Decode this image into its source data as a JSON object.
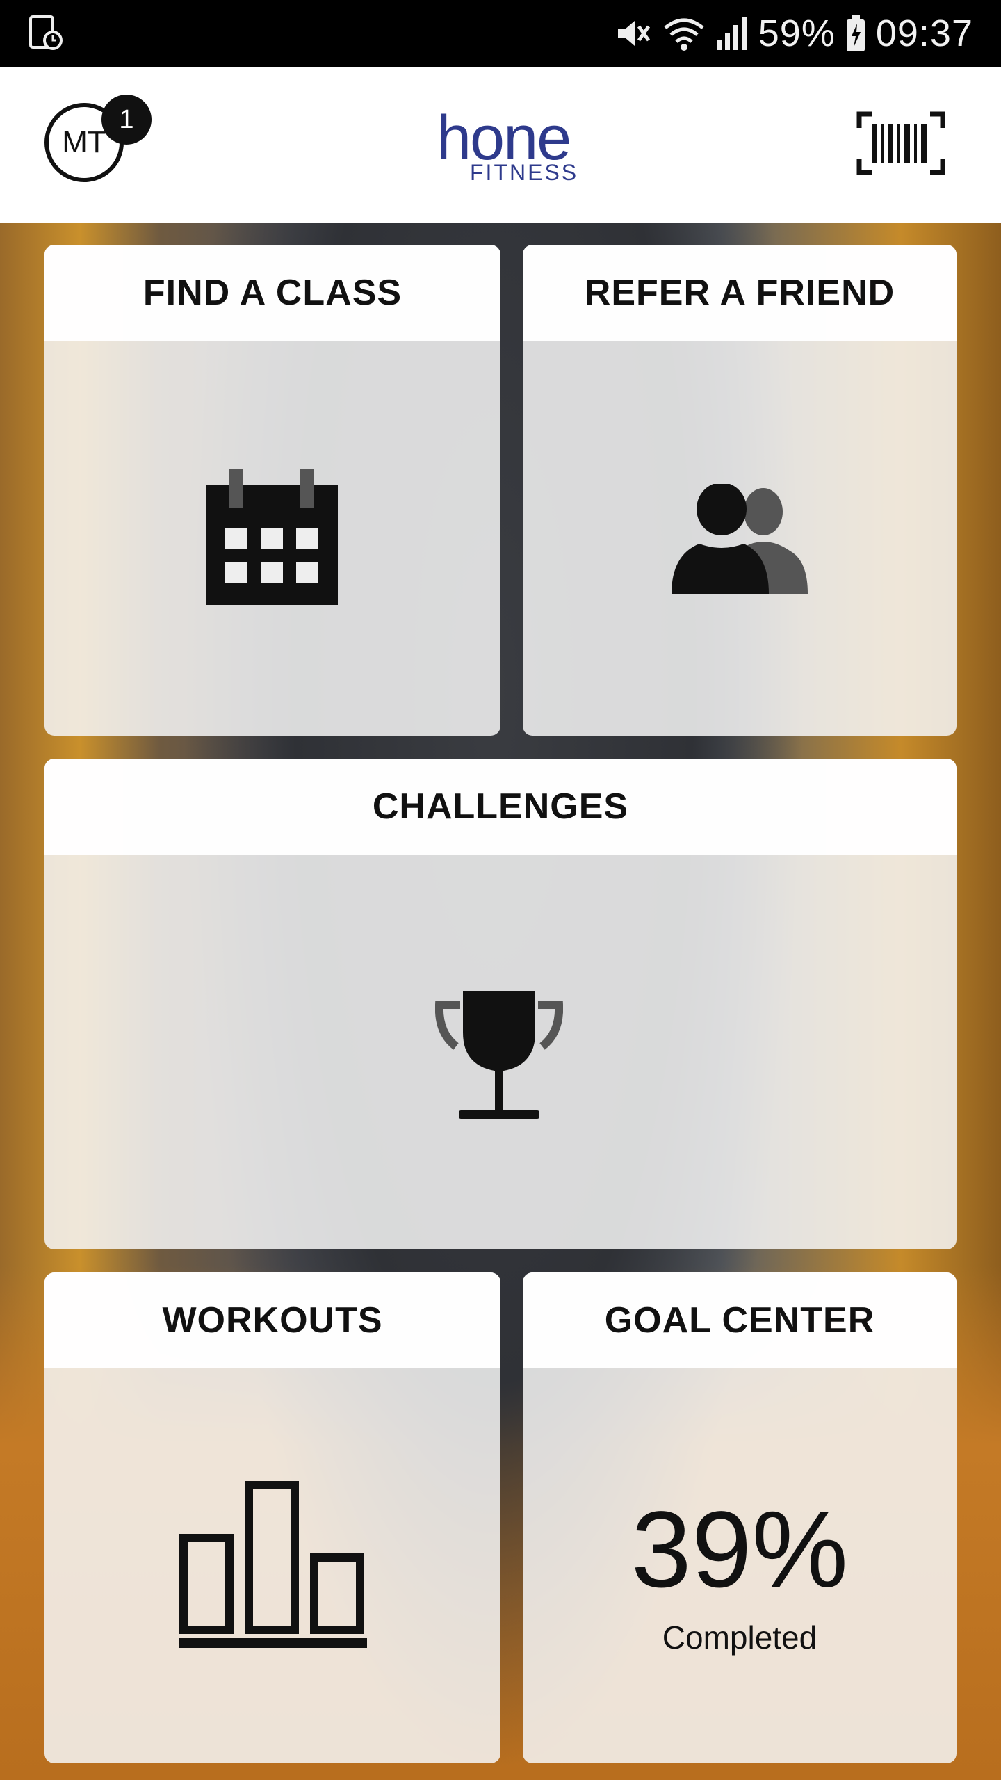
{
  "status_bar": {
    "battery": "59%",
    "time": "09:37"
  },
  "header": {
    "avatar_initials": "MT",
    "notification_count": "1",
    "logo_main": "hone",
    "logo_sub": "FITNESS"
  },
  "tiles": {
    "find_class": {
      "label": "FIND A CLASS",
      "icon": "calendar-icon"
    },
    "refer_friend": {
      "label": "REFER A FRIEND",
      "icon": "users-icon"
    },
    "challenges": {
      "label": "CHALLENGES",
      "icon": "trophy-icon"
    },
    "workouts": {
      "label": "WORKOUTS",
      "icon": "bar-chart-icon"
    },
    "goal_center": {
      "label": "GOAL CENTER",
      "value": "39%",
      "sub_label": "Completed"
    }
  }
}
